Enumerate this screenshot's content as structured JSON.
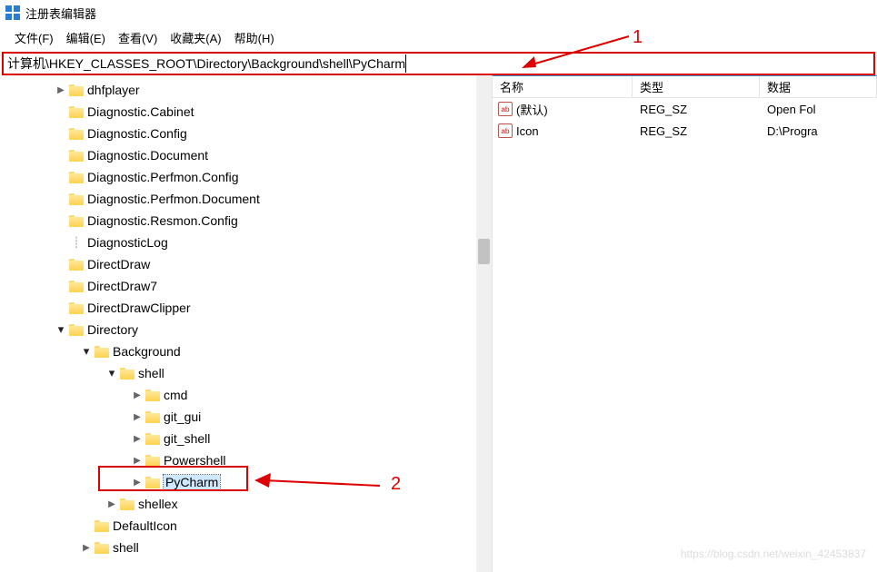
{
  "title": "注册表编辑器",
  "menu": {
    "file": "文件(F)",
    "edit": "编辑(E)",
    "view": "查看(V)",
    "favorites": "收藏夹(A)",
    "help": "帮助(H)"
  },
  "address": "计算机\\HKEY_CLASSES_ROOT\\Directory\\Background\\shell\\PyCharm",
  "tree": [
    {
      "indent": 0,
      "exp": ">",
      "label": "dhfplayer"
    },
    {
      "indent": 0,
      "exp": "",
      "label": "Diagnostic.Cabinet"
    },
    {
      "indent": 0,
      "exp": "",
      "label": "Diagnostic.Config"
    },
    {
      "indent": 0,
      "exp": "",
      "label": "Diagnostic.Document"
    },
    {
      "indent": 0,
      "exp": "",
      "label": "Diagnostic.Perfmon.Config"
    },
    {
      "indent": 0,
      "exp": "",
      "label": "Diagnostic.Perfmon.Document"
    },
    {
      "indent": 0,
      "exp": "",
      "label": "Diagnostic.Resmon.Config"
    },
    {
      "indent": 0,
      "exp": "",
      "label": "DiagnosticLog",
      "noFolder": true
    },
    {
      "indent": 0,
      "exp": "",
      "label": "DirectDraw"
    },
    {
      "indent": 0,
      "exp": "",
      "label": "DirectDraw7"
    },
    {
      "indent": 0,
      "exp": "",
      "label": "DirectDrawClipper"
    },
    {
      "indent": 0,
      "exp": "v",
      "label": "Directory"
    },
    {
      "indent": 1,
      "exp": "v",
      "label": "Background"
    },
    {
      "indent": 2,
      "exp": "v",
      "label": "shell"
    },
    {
      "indent": 3,
      "exp": ">",
      "label": "cmd"
    },
    {
      "indent": 3,
      "exp": ">",
      "label": "git_gui"
    },
    {
      "indent": 3,
      "exp": ">",
      "label": "git_shell"
    },
    {
      "indent": 3,
      "exp": ">",
      "label": "Powershell"
    },
    {
      "indent": 3,
      "exp": ">",
      "label": "PyCharm",
      "selected": true
    },
    {
      "indent": 2,
      "exp": ">",
      "label": "shellex"
    },
    {
      "indent": 1,
      "exp": "",
      "label": "DefaultIcon"
    },
    {
      "indent": 1,
      "exp": ">",
      "label": "shell"
    }
  ],
  "list": {
    "headers": {
      "name": "名称",
      "type": "类型",
      "data": "数据"
    },
    "rows": [
      {
        "name": "(默认)",
        "type": "REG_SZ",
        "data": "Open Fol"
      },
      {
        "name": "Icon",
        "type": "REG_SZ",
        "data": "D:\\Progra"
      }
    ]
  },
  "annot": {
    "one": "1",
    "two": "2"
  },
  "watermark": "https://blog.csdn.net/weixin_42453837"
}
